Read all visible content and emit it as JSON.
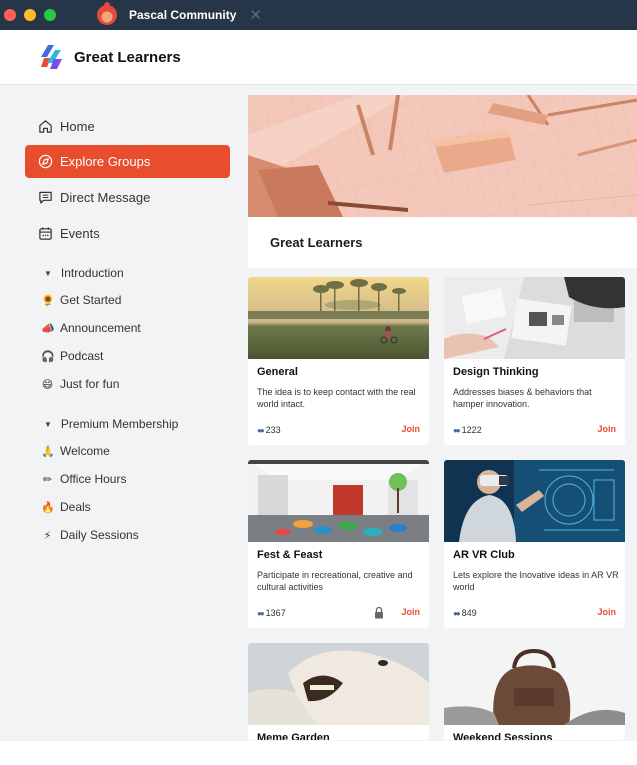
{
  "window": {
    "tab_title": "Pascal Community",
    "tab_close": "✕"
  },
  "header": {
    "brand_name": "Great Learners"
  },
  "sidebar": {
    "nav": [
      {
        "label": "Home",
        "icon": "home-icon"
      },
      {
        "label": "Explore Groups",
        "icon": "compass-icon",
        "active": true
      },
      {
        "label": "Direct Message",
        "icon": "message-icon"
      },
      {
        "label": "Events",
        "icon": "calendar-icon"
      }
    ],
    "sections": [
      {
        "title": "Introduction",
        "items": [
          {
            "label": "Get Started",
            "icon": "sunflower-icon",
            "glyph": "🌻"
          },
          {
            "label": "Announcement",
            "icon": "megaphone-icon",
            "glyph": "📣"
          },
          {
            "label": "Podcast",
            "icon": "headphones-icon",
            "glyph": "🎧"
          },
          {
            "label": "Just for fun",
            "icon": "grin-icon",
            "glyph": "😄"
          }
        ]
      },
      {
        "title": "Premium Membership",
        "items": [
          {
            "label": "Welcome",
            "icon": "folded-hands-icon",
            "glyph": "🙏"
          },
          {
            "label": "Office Hours",
            "icon": "pencil-icon",
            "glyph": "✏"
          },
          {
            "label": "Deals",
            "icon": "fire-icon",
            "glyph": "🔥"
          },
          {
            "label": "Daily Sessions",
            "icon": "lightning-icon",
            "glyph": "⚡"
          }
        ]
      }
    ]
  },
  "main": {
    "hero_title": "Great Learners",
    "join_label": "Join",
    "groups": [
      {
        "title": "General",
        "description": "The idea is to keep contact with the real world intact.",
        "members": "233",
        "locked": false
      },
      {
        "title": "Design Thinking",
        "description": "Addresses biases & behaviors that hamper innovation.",
        "members": "1222",
        "locked": false
      },
      {
        "title": "Fest & Feast",
        "description": "Participate in recreational, creative and cultural activities",
        "members": "1367",
        "locked": true
      },
      {
        "title": "AR VR Club",
        "description": "Lets explore the Inovative ideas in AR VR world",
        "members": "849",
        "locked": false
      },
      {
        "title": "Meme Garden"
      },
      {
        "title": "Weekend Sessions"
      }
    ]
  },
  "colors": {
    "accent": "#e84d2e",
    "titlebar": "#263548"
  }
}
